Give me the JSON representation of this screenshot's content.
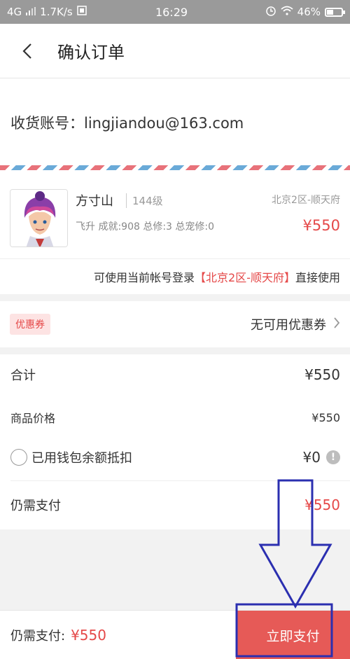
{
  "status_bar": {
    "network": "4G",
    "speed": "1.7K/s",
    "time": "16:29",
    "battery": "46%"
  },
  "header": {
    "title": "确认订单"
  },
  "account": {
    "text": "收货账号：lingjiandou@163.com"
  },
  "product": {
    "name": "方寸山",
    "level": "144级",
    "server": "北京2区-顺天府",
    "stats": "飞升  成就:908  总修:3  总宠修:0",
    "price": "¥550"
  },
  "login_tip": {
    "prefix": "可使用当前帐号登录",
    "highlight": "【北京2区-顺天府】",
    "suffix": "直接使用"
  },
  "coupon": {
    "tag": "优惠券",
    "value": "无可用优惠券"
  },
  "summary": {
    "total_label": "合计",
    "total_value": "¥550",
    "goods_label": "商品价格",
    "goods_value": "¥550",
    "wallet_label": "已用钱包余额抵扣",
    "wallet_value": "¥0",
    "need_label": "仍需支付",
    "need_value": "¥550"
  },
  "bottom_bar": {
    "label": "仍需支付:",
    "price": "¥550",
    "button": "立即支付"
  },
  "colors": {
    "accent": "#e54848",
    "pay_button": "#e65a57",
    "annotation": "#2b2fb0"
  }
}
